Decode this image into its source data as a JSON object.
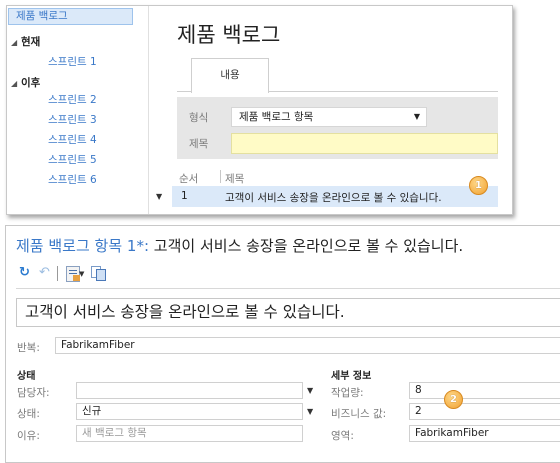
{
  "backlog": {
    "sidebar": {
      "selected": "제품 백로그",
      "current_header": "현재",
      "current_items": [
        "스프린트 1"
      ],
      "future_header": "이후",
      "future_items": [
        "스프린트 2",
        "스프린트 3",
        "스프린트 4",
        "스프린트 5",
        "스프린트 6"
      ]
    },
    "page_title": "제품 백로그",
    "tab_label": "내용",
    "form": {
      "type_label": "형식",
      "type_value": "제품 백로그 항목",
      "title_label": "제목",
      "title_value": ""
    },
    "table": {
      "headers": [
        "순서",
        "제목"
      ],
      "rows": [
        {
          "order": "1",
          "title": "고객이 서비스 송장을 온라인으로 볼 수 있습니다."
        }
      ]
    },
    "callout": "1"
  },
  "work_item": {
    "title_prefix": "제품 백로그 항목 1*:",
    "title_rest": "고객이 서비스 송장을 온라인으로 볼 수 있습니다.",
    "title_field": "고객이 서비스 송장을 온라인으로 볼 수 있습니다.",
    "iteration_label": "반복:",
    "iteration_value": "FabrikamFiber",
    "status": {
      "header": "상태",
      "assigned_label": "담당자:",
      "assigned_value": "",
      "state_label": "상태:",
      "state_value": "신규",
      "reason_label": "이유:",
      "reason_value": "새 백로그 항목"
    },
    "details": {
      "header": "세부 정보",
      "effort_label": "작업량:",
      "effort_value": "8",
      "business_value_label": "비즈니스 값:",
      "business_value_value": "2",
      "area_label": "영역:",
      "area_value": "FabrikamFiber"
    },
    "callout": "2"
  },
  "colors": {
    "link": "#3a78c8",
    "selection": "#dbe9f9",
    "required_field": "#fffbc6",
    "callout": "#f0a030"
  }
}
